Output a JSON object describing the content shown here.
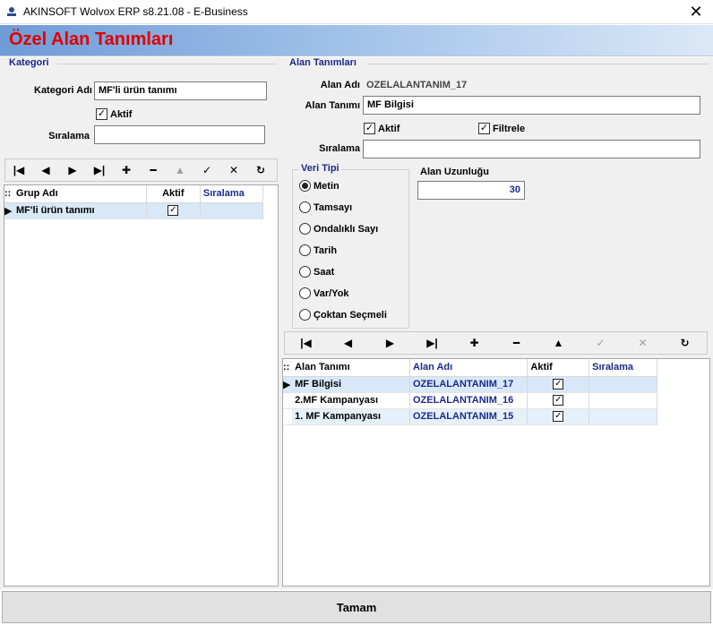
{
  "window": {
    "title": "AKINSOFT Wolvox ERP s8.21.08 - E-Business"
  },
  "header": {
    "title": "Özel Alan Tanımları"
  },
  "kategori": {
    "group_title": "Kategori",
    "name_label": "Kategori Adı",
    "name_value": "MF'li ürün tanımı",
    "aktif_label": "Aktif",
    "siralama_label": "Sıralama",
    "siralama_value": "",
    "grid": {
      "columns": [
        "Grup Adı",
        "Aktif",
        "Sıralama"
      ],
      "rows": [
        {
          "grup_adi": "MF'li ürün tanımı",
          "aktif": true,
          "siralama": ""
        }
      ]
    }
  },
  "alan": {
    "group_title": "Alan Tanımları",
    "alan_adi_label": "Alan Adı",
    "alan_adi_value": "OZELALANTANIM_17",
    "alan_tanimi_label": "Alan Tanımı",
    "alan_tanimi_value": "MF Bilgisi",
    "aktif_label": "Aktif",
    "filtrele_label": "Filtrele",
    "siralama_label": "Sıralama",
    "siralama_value": "",
    "veri_tipi": {
      "title": "Veri Tipi",
      "options": [
        "Metin",
        "Tamsayı",
        "Ondalıklı Sayı",
        "Tarih",
        "Saat",
        "Var/Yok",
        "Çoktan Seçmeli"
      ],
      "selected": "Metin"
    },
    "uzunluk_label": "Alan Uzunluğu",
    "uzunluk_value": "30",
    "grid": {
      "columns": [
        "Alan Tanımı",
        "Alan Adı",
        "Aktif",
        "Sıralama"
      ],
      "rows": [
        {
          "alan_tanimi": "MF Bilgisi",
          "alan_adi": "OZELALANTANIM_17",
          "aktif": true,
          "siralama": ""
        },
        {
          "alan_tanimi": "2.MF Kampanyası",
          "alan_adi": "OZELALANTANIM_16",
          "aktif": true,
          "siralama": ""
        },
        {
          "alan_tanimi": "1. MF Kampanyası",
          "alan_adi": "OZELALANTANIM_15",
          "aktif": true,
          "siralama": ""
        }
      ]
    }
  },
  "footer": {
    "ok_label": "Tamam"
  }
}
